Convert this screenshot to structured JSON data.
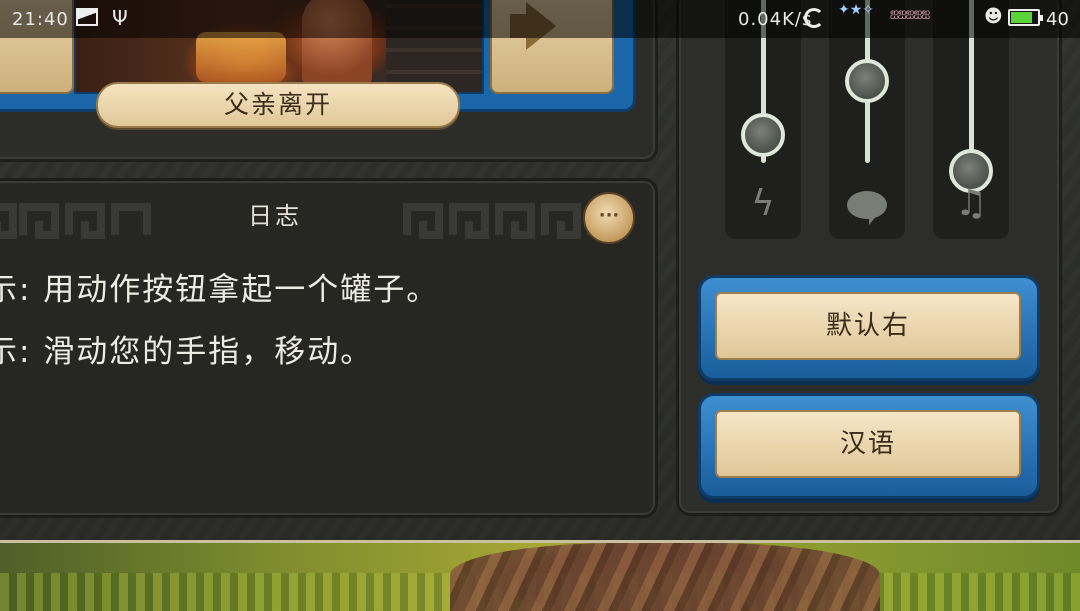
{
  "status_bar": {
    "time": "21:40",
    "network_speed": "0.04K/s",
    "battery_level": "40",
    "icons": [
      "image-notification-icon",
      "usb-icon",
      "sync-icon",
      "stars-icon",
      "character-stickers-icon",
      "face-icon",
      "battery-icon"
    ]
  },
  "chapter": {
    "title": "父亲离开",
    "prev_icon": "arrow-left-icon",
    "next_icon": "arrow-right-icon"
  },
  "log": {
    "title": "日志",
    "more_label": "···",
    "lines": [
      "示: 用动作按钮拿起一个罐子。",
      "示: 滑动您的手指，移动。"
    ]
  },
  "audio": {
    "sliders": [
      {
        "name": "effects",
        "icon": "lightning-icon",
        "glyph": "ϟ",
        "level": 0.3
      },
      {
        "name": "voice",
        "icon": "speech-bubble-icon",
        "glyph": "",
        "level": 0.75
      },
      {
        "name": "music",
        "icon": "music-note-icon",
        "glyph": "♫",
        "level": 0.0
      }
    ]
  },
  "controls": {
    "layout_button_label": "默认右",
    "language_button_label": "汉语"
  },
  "colors": {
    "panel_blue": "#1a66a8",
    "wood": "#e0c798",
    "background": "#2a2b27"
  }
}
